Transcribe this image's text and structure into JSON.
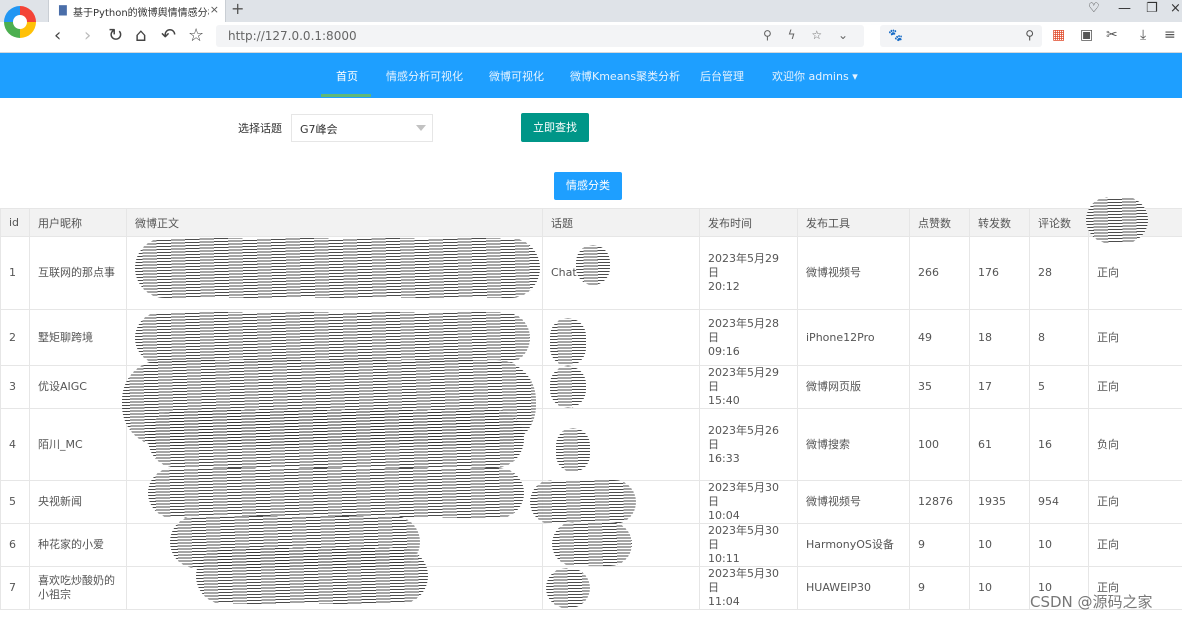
{
  "browser": {
    "tab_title": "基于Python的微博舆情情感分析",
    "address": "http://127.0.0.1:8000"
  },
  "nav": {
    "items": [
      {
        "label": "首页",
        "active": true
      },
      {
        "label": "情感分析可视化"
      },
      {
        "label": "微博可视化"
      },
      {
        "label": "微博Kmeans聚类分析"
      },
      {
        "label": "后台管理"
      },
      {
        "label": "欢迎你 admins"
      }
    ]
  },
  "form": {
    "topic_label": "选择话题",
    "topic_value": "G7峰会",
    "search_button": "立即查找",
    "classify_button": "情感分类"
  },
  "table": {
    "headers": [
      "id",
      "用户昵称",
      "微博正文",
      "话题",
      "发布时间",
      "发布工具",
      "点赞数",
      "转发数",
      "评论数",
      ""
    ],
    "rows": [
      {
        "id": "1",
        "user": "互联网的那点事",
        "text": "",
        "topic": "Chat",
        "date": "2023年5月29日",
        "time": "20:12",
        "tool": "微博视频号",
        "likes": "266",
        "reposts": "176",
        "comments": "28",
        "sentiment": "正向"
      },
      {
        "id": "2",
        "user": "墅矩聊跨境",
        "text": "",
        "topic": "",
        "date": "2023年5月28日",
        "time": "09:16",
        "tool": "iPhone12Pro",
        "likes": "49",
        "reposts": "18",
        "comments": "8",
        "sentiment": "正向"
      },
      {
        "id": "3",
        "user": "优设AIGC",
        "text": "",
        "topic": "",
        "date": "2023年5月29日",
        "time": "15:40",
        "tool": "微博网页版",
        "likes": "35",
        "reposts": "17",
        "comments": "5",
        "sentiment": "正向"
      },
      {
        "id": "4",
        "user": "陌川_MC",
        "text": "",
        "topic": "",
        "date": "2023年5月26日",
        "time": "16:33",
        "tool": "微博搜索",
        "likes": "100",
        "reposts": "61",
        "comments": "16",
        "sentiment": "负向"
      },
      {
        "id": "5",
        "user": "央视新闻",
        "text": "",
        "topic": "",
        "date": "2023年5月30日",
        "time": "10:04",
        "tool": "微博视频号",
        "likes": "12876",
        "reposts": "1935",
        "comments": "954",
        "sentiment": "正向"
      },
      {
        "id": "6",
        "user": "种花家的小爱",
        "text": "",
        "topic": "",
        "date": "2023年5月30日",
        "time": "10:11",
        "tool": "HarmonyOS设备",
        "likes": "9",
        "reposts": "10",
        "comments": "10",
        "sentiment": "正向"
      },
      {
        "id": "7",
        "user": "喜欢吃炒酸奶的小祖宗",
        "text": "",
        "topic": "",
        "date": "2023年5月30日",
        "time": "11:04",
        "tool": "HUAWEIP30",
        "likes": "9",
        "reposts": "10",
        "comments": "10",
        "sentiment": "正向"
      }
    ]
  },
  "watermark": "CSDN @源码之家"
}
